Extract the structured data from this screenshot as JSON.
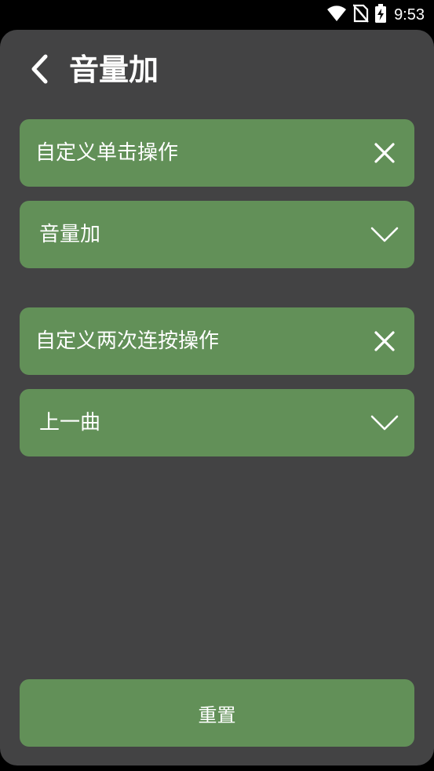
{
  "status_bar": {
    "time": "9:53",
    "icons": [
      "wifi-icon",
      "no-sim-icon",
      "battery-charging-icon"
    ]
  },
  "header": {
    "back_icon": "chevron-left-icon",
    "title": "音量加"
  },
  "sections": [
    {
      "header_label": "自定义单击操作",
      "header_icon": "close-icon",
      "selected_value": "音量加",
      "select_icon": "chevron-down-icon"
    },
    {
      "header_label": "自定义两次连按操作",
      "header_icon": "close-icon",
      "selected_value": "上一曲",
      "select_icon": "chevron-down-icon"
    }
  ],
  "reset_label": "重置",
  "colors": {
    "panel_bg": "#434344",
    "card_bg": "#629058",
    "text": "#ffffff"
  }
}
